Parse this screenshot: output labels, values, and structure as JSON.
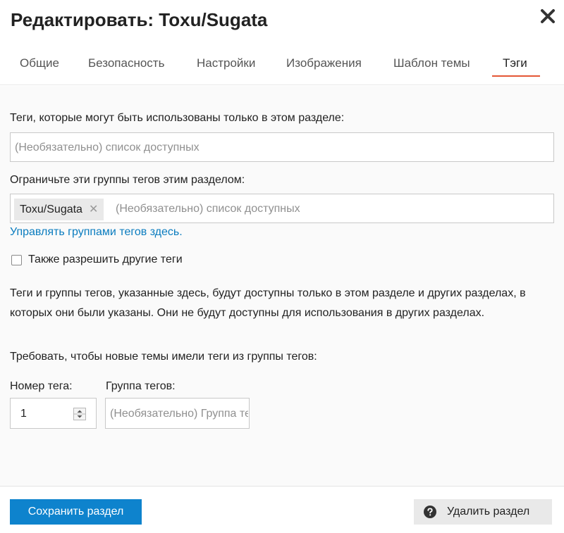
{
  "modal": {
    "title": "Редактировать: Toxu/Sugata"
  },
  "tabs": [
    {
      "label": "Общие"
    },
    {
      "label": "Безопасность"
    },
    {
      "label": "Настройки"
    },
    {
      "label": "Изображения"
    },
    {
      "label": "Шаблон темы"
    },
    {
      "label": "Тэги",
      "active": true
    }
  ],
  "tags_section": {
    "allowed_tags_label": "Теги, которые могут быть использованы только в этом разделе:",
    "allowed_tags_placeholder": "(Необязательно) список доступных",
    "tag_groups_label": "Ограничьте эти группы тегов этим разделом:",
    "tag_group_chip": "Toxu/Sugata",
    "tag_groups_placeholder": "(Необязательно) список доступных",
    "manage_link": "Управлять группами тегов здесь.",
    "allow_other_tags_label": "Также разрешить другие теги",
    "allow_other_tags_checked": false,
    "description": "Теги и группы тегов, указанные здесь, будут доступны только в этом разделе и других разделах, в которых они были указаны. Они не будут доступны для использования в других разделах.",
    "require_label": "Требовать, чтобы новые темы имели теги из группы тегов:",
    "tag_number_label": "Номер тега:",
    "tag_number_value": "1",
    "tag_group_label": "Группа тегов:",
    "tag_group_placeholder": "(Необязательно) Группа тегов"
  },
  "footer": {
    "save_label": "Сохранить раздел",
    "delete_label": "Удалить раздел"
  },
  "colors": {
    "primary": "#0e83cd",
    "link": "#0a7cbf",
    "active_tab_underline": "#e45735"
  },
  "icons": {
    "close": "close-icon",
    "chip_remove": "remove-x-icon",
    "stepper": "stepper-arrows-icon",
    "delete": "question-circle-icon"
  }
}
